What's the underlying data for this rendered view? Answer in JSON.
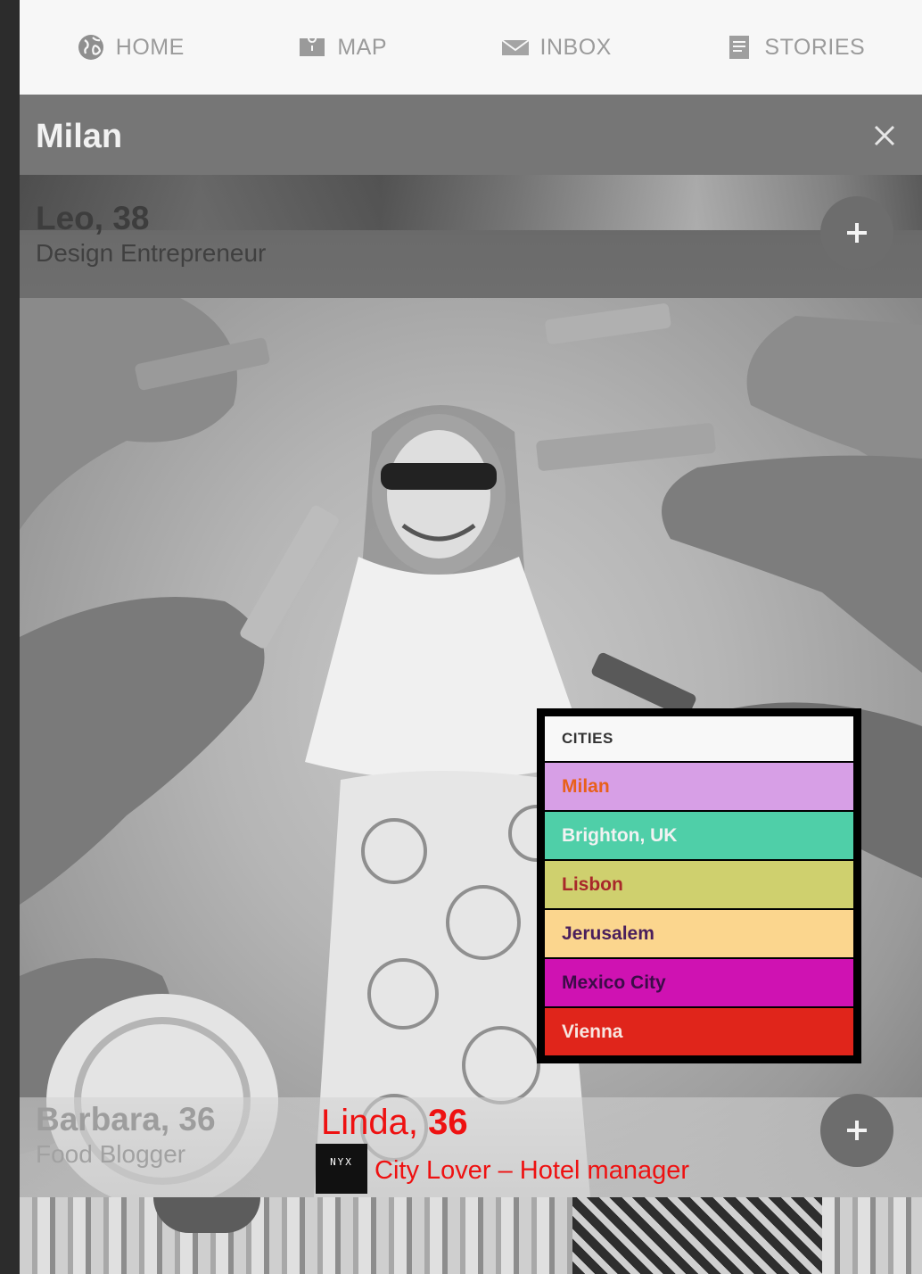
{
  "nav": {
    "items": [
      {
        "label": "HOME",
        "icon": "globe-icon"
      },
      {
        "label": "MAP",
        "icon": "map-icon"
      },
      {
        "label": "INBOX",
        "icon": "envelope-icon"
      },
      {
        "label": "STORIES",
        "icon": "document-icon"
      }
    ]
  },
  "header": {
    "title": "Milan",
    "close_icon": "close-icon"
  },
  "profiles": {
    "leo": {
      "name": "Leo, 38",
      "role": "Design Entrepreneur"
    },
    "barbara": {
      "name": "Barbara, 36",
      "role": "Food Blogger"
    },
    "linda": {
      "name_prefix": "Linda,",
      "age": "36",
      "role": "City Lover – Hotel manager",
      "logo_text": "NYX"
    }
  },
  "cities": {
    "title": "CITIES",
    "items": [
      {
        "label": "Milan",
        "bg": "#d79fe6",
        "fg": "#e8601a"
      },
      {
        "label": "Brighton, UK",
        "bg": "#4fcfa8",
        "fg": "#f2f2f2"
      },
      {
        "label": "Lisbon",
        "bg": "#cfd06e",
        "fg": "#a8282a"
      },
      {
        "label": "Jerusalem",
        "bg": "#fbd68e",
        "fg": "#4a1f5c"
      },
      {
        "label": "Mexico City",
        "bg": "#cf12b2",
        "fg": "#3c0c48"
      },
      {
        "label": "Vienna",
        "bg": "#e0251b",
        "fg": "#f7e6e0"
      }
    ]
  }
}
